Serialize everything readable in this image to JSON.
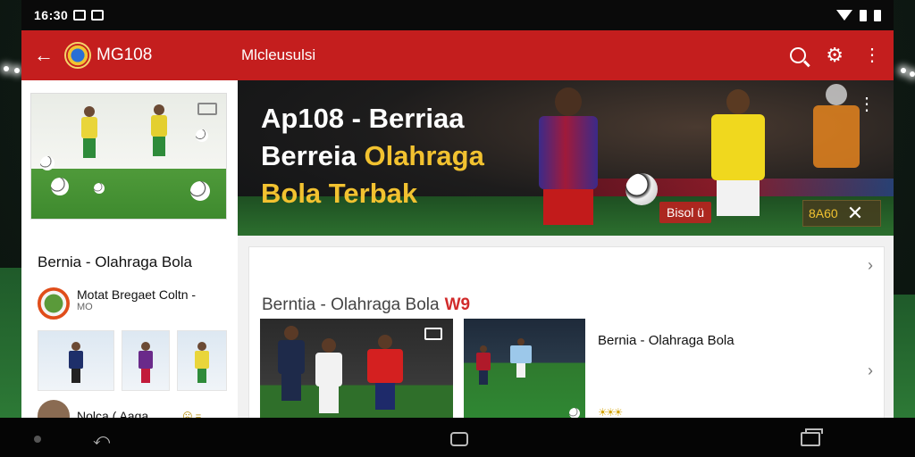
{
  "status": {
    "time": "16:30"
  },
  "appbar": {
    "brand": "MG108",
    "title": "Mlcleusulsi"
  },
  "hero": {
    "title_line1": "Ap108 - Berriaa",
    "title_line2_white": "Berreia ",
    "title_line2_accent": "Olahraga",
    "title_line3": "Bola Terbak",
    "chip_red": "Bisol ü",
    "chip_gold": "8A60",
    "close": "✕"
  },
  "sidebar": {
    "title": "Bernia - Olahraga Bola",
    "item1_title": "Motat Bregaet Coltn -",
    "item1_sub": "MO",
    "item2_title": "Nolca ( Aaga",
    "item2_meta": "☹ ="
  },
  "content": {
    "card_title": "Berntia - Olahraga Bola",
    "card_tag": "W9",
    "row_title": "Bernia - Olahraga Bola",
    "row_meta": "☀☀☀"
  },
  "colors": {
    "brand_red": "#c41e1e",
    "accent_gold": "#f2c230"
  }
}
